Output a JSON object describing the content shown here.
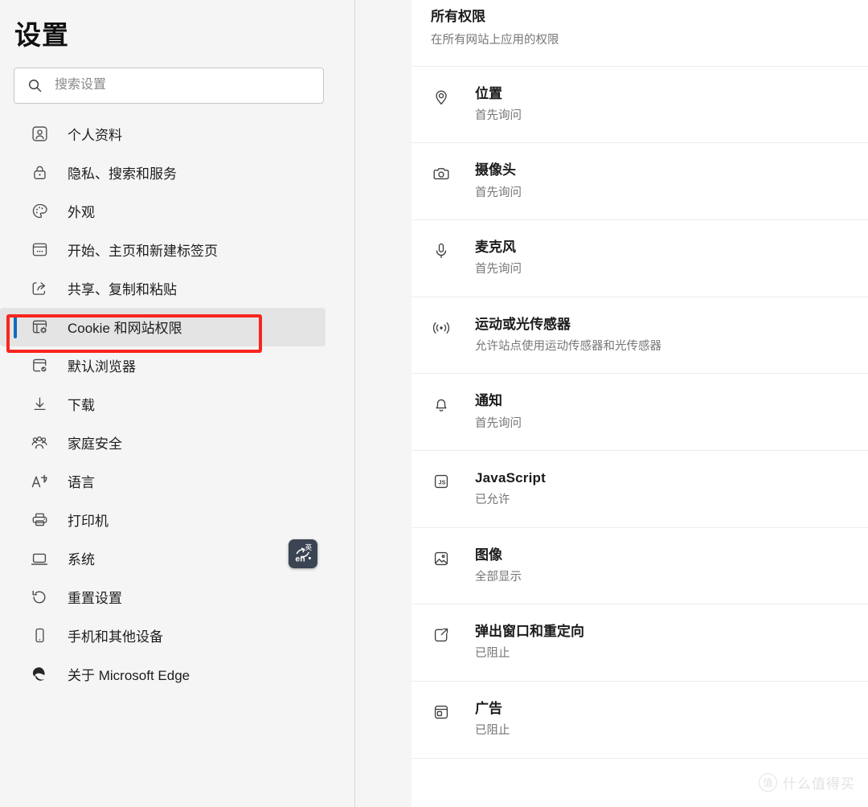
{
  "sidebar": {
    "title": "设置",
    "search": {
      "placeholder": "搜索设置",
      "value": "",
      "icon": "search-icon"
    },
    "items": [
      {
        "label": "个人资料",
        "icon": "profile-icon",
        "selected": false
      },
      {
        "label": "隐私、搜索和服务",
        "icon": "lock-icon",
        "selected": false
      },
      {
        "label": "外观",
        "icon": "palette-icon",
        "selected": false
      },
      {
        "label": "开始、主页和新建标签页",
        "icon": "window-dots-icon",
        "selected": false
      },
      {
        "label": "共享、复制和粘贴",
        "icon": "share-icon",
        "selected": false
      },
      {
        "label": "Cookie 和网站权限",
        "icon": "cookie-gear-icon",
        "selected": true
      },
      {
        "label": "默认浏览器",
        "icon": "browser-check-icon",
        "selected": false
      },
      {
        "label": "下载",
        "icon": "download-icon",
        "selected": false
      },
      {
        "label": "家庭安全",
        "icon": "family-icon",
        "selected": false
      },
      {
        "label": "语言",
        "icon": "language-icon",
        "selected": false
      },
      {
        "label": "打印机",
        "icon": "printer-icon",
        "selected": false
      },
      {
        "label": "系统",
        "icon": "laptop-icon",
        "selected": false
      },
      {
        "label": "重置设置",
        "icon": "reset-icon",
        "selected": false
      },
      {
        "label": "手机和其他设备",
        "icon": "phone-icon",
        "selected": false
      },
      {
        "label": "关于 Microsoft Edge",
        "icon": "edge-logo-icon",
        "selected": false
      }
    ]
  },
  "annotation": {
    "color": "#f8261e",
    "target_label": "Cookie 和网站权限"
  },
  "ime_badge": {
    "latin": "en",
    "cjk": "英",
    "color": "#3b4452"
  },
  "main": {
    "section": {
      "title": "所有权限",
      "subtitle": "在所有网站上应用的权限"
    },
    "permissions": [
      {
        "label": "位置",
        "status": "首先询问",
        "icon": "location-pin-icon",
        "latin": false
      },
      {
        "label": "摄像头",
        "status": "首先询问",
        "icon": "camera-icon",
        "latin": false
      },
      {
        "label": "麦克风",
        "status": "首先询问",
        "icon": "microphone-icon",
        "latin": false
      },
      {
        "label": "运动或光传感器",
        "status": "允许站点使用运动传感器和光传感器",
        "icon": "motion-sensor-icon",
        "latin": false
      },
      {
        "label": "通知",
        "status": "首先询问",
        "icon": "bell-icon",
        "latin": false
      },
      {
        "label": "JavaScript",
        "status": "已允许",
        "icon": "javascript-icon",
        "latin": true
      },
      {
        "label": "图像",
        "status": "全部显示",
        "icon": "image-icon",
        "latin": false
      },
      {
        "label": "弹出窗口和重定向",
        "status": "已阻止",
        "icon": "external-link-icon",
        "latin": false
      },
      {
        "label": "广告",
        "status": "已阻止",
        "icon": "ads-icon",
        "latin": false
      }
    ]
  },
  "watermark": {
    "badge": "值",
    "text": "什么值得买"
  },
  "colors": {
    "accent": "#0f6cbd",
    "annotation": "#f8261e",
    "sidebar_bg": "#f5f5f5",
    "content_bg": "#ffffff",
    "selected_row_bg": "#e4e4e4"
  }
}
